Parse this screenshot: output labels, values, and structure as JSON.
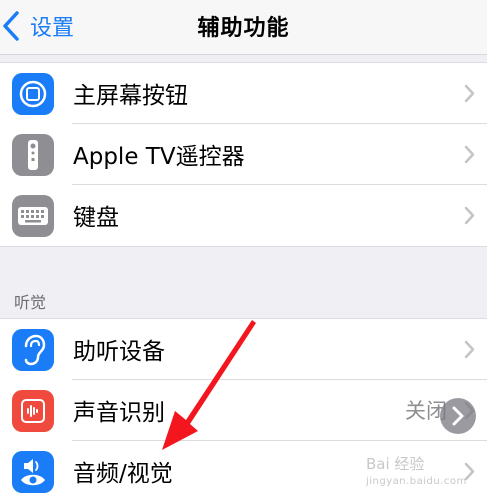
{
  "nav": {
    "back_label": "设置",
    "title": "辅助功能"
  },
  "group1": [
    {
      "label": "主屏幕按钮",
      "icon": "home-button-icon",
      "color": "#1a7cf6"
    },
    {
      "label": "Apple TV遥控器",
      "icon": "apple-tv-remote-icon",
      "color": "#8e8e93"
    },
    {
      "label": "键盘",
      "icon": "keyboard-icon",
      "color": "#8e8e93"
    }
  ],
  "section_header": "听觉",
  "group2": [
    {
      "label": "助听设备",
      "icon": "ear-icon",
      "color": "#1a7cf6"
    },
    {
      "label": "声音识别",
      "value": "关闭",
      "icon": "sound-recognition-icon",
      "color": "#f04a3f"
    },
    {
      "label": "音频/视觉",
      "icon": "audio-visual-icon",
      "color": "#1a7cf6"
    }
  ],
  "watermark": {
    "line1": "Bai 经验",
    "line2": "jingyan.baidu.com"
  },
  "accent_color": "#1a7cf6"
}
